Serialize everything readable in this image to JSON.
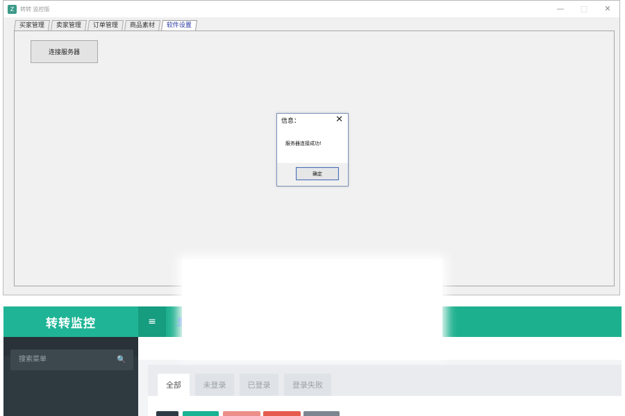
{
  "window": {
    "title": "转转 监控版",
    "controls": {
      "minimize": "—",
      "maximize": "□",
      "close": "✕"
    },
    "tabs": [
      {
        "label": "买家管理",
        "active": false
      },
      {
        "label": "卖家管理",
        "active": false
      },
      {
        "label": "订单管理",
        "active": false
      },
      {
        "label": "商品素材",
        "active": false
      },
      {
        "label": "软件设置",
        "active": true
      }
    ],
    "connect_button": "连接服务器"
  },
  "dialog": {
    "title": "信息：",
    "close": "✕",
    "message": "服务器连接成功!",
    "ok_button": "确定"
  },
  "web": {
    "brand": "转转监控",
    "menu_icon": "≡",
    "user_icon": "👤",
    "search_placeholder": "搜索菜单",
    "search_icon": "🔍",
    "filter_tabs": [
      {
        "label": "全部",
        "active": true
      },
      {
        "label": "未登录",
        "active": false
      },
      {
        "label": "已登录",
        "active": false
      },
      {
        "label": "登录失败",
        "active": false
      }
    ],
    "colors": {
      "brand": "#1fb495",
      "sidebar": "#2e3940",
      "btn_dark": "#2f3b44",
      "btn_teal": "#1ab394",
      "btn_pink": "#ec8e8a",
      "btn_red": "#e55c4f",
      "btn_gray": "#7d8690"
    }
  }
}
